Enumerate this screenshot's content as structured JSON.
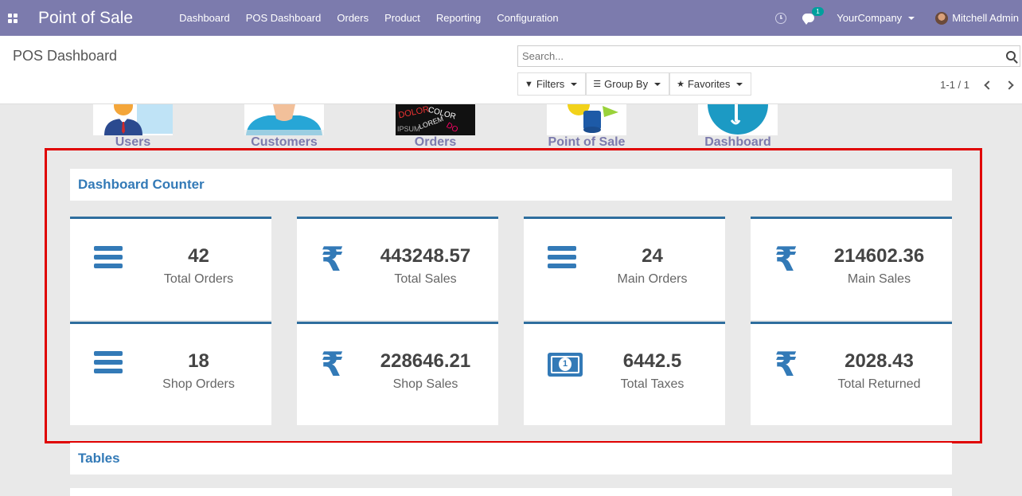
{
  "navbar": {
    "app_title": "Point of Sale",
    "menu": [
      "Dashboard",
      "POS Dashboard",
      "Orders",
      "Product",
      "Reporting",
      "Configuration"
    ],
    "chat_badge": "1",
    "company": "YourCompany",
    "user": "Mitchell Admin"
  },
  "control_panel": {
    "breadcrumb": "POS Dashboard",
    "search_placeholder": "Search...",
    "filters_label": "Filters",
    "group_by_label": "Group By",
    "favorites_label": "Favorites",
    "pager": "1-1 / 1"
  },
  "tiles": [
    "Users",
    "Customers",
    "Orders",
    "Point of Sale",
    "Dashboard"
  ],
  "sections": {
    "counter_title": "Dashboard Counter",
    "tables_title": "Tables"
  },
  "cards": [
    {
      "icon": "bars-icon",
      "value": "42",
      "label": "Total Orders"
    },
    {
      "icon": "rupee-icon",
      "value": "443248.57",
      "label": "Total Sales"
    },
    {
      "icon": "bars-icon",
      "value": "24",
      "label": "Main Orders"
    },
    {
      "icon": "rupee-icon",
      "value": "214602.36",
      "label": "Main Sales"
    },
    {
      "icon": "bars-icon",
      "value": "18",
      "label": "Shop Orders"
    },
    {
      "icon": "rupee-icon",
      "value": "228646.21",
      "label": "Shop Sales"
    },
    {
      "icon": "money-icon",
      "value": "6442.5",
      "label": "Total Taxes"
    },
    {
      "icon": "rupee-icon",
      "value": "2028.43",
      "label": "Total Returned"
    }
  ],
  "colors": {
    "navbar": "#7c7bad",
    "accent": "#337ab7",
    "highlight": "#e00000"
  }
}
